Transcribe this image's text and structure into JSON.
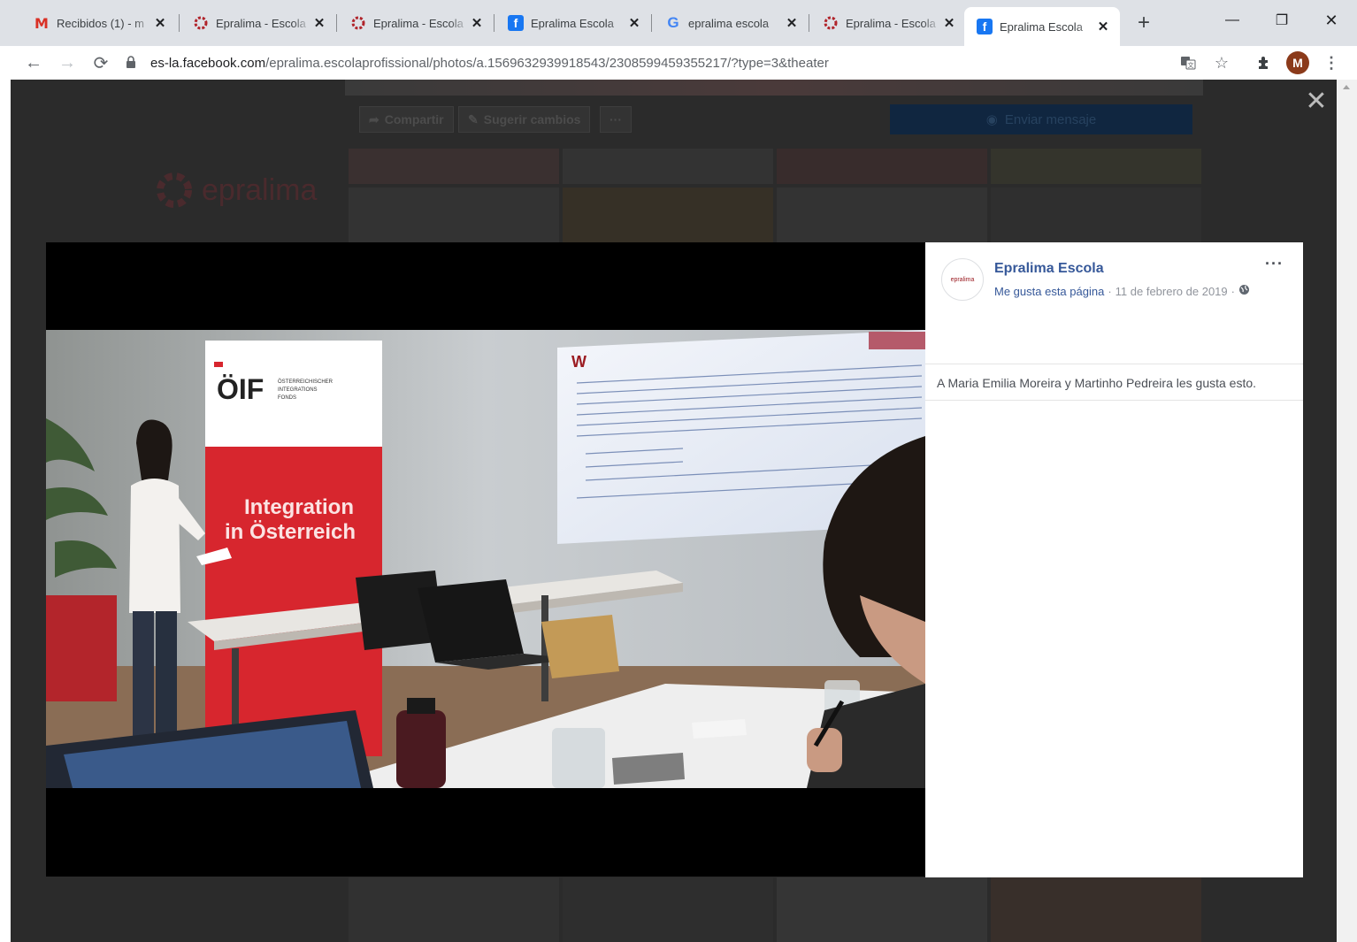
{
  "browser": {
    "tabs": [
      {
        "title": "Recibidos (1) - m",
        "favicon": "gmail-icon"
      },
      {
        "title": "Epralima - Escola",
        "favicon": "epralima-icon"
      },
      {
        "title": "Epralima - Escola",
        "favicon": "epralima-icon"
      },
      {
        "title": "Epralima Escola",
        "favicon": "facebook-icon"
      },
      {
        "title": "epralima escola",
        "favicon": "google-icon"
      },
      {
        "title": "Epralima - Escola",
        "favicon": "epralima-icon"
      },
      {
        "title": "Epralima Escola",
        "favicon": "facebook-icon",
        "active": true
      }
    ],
    "url_host": "es-la.facebook.com",
    "url_path": "/epralima.escolaprofissional/photos/a.1569632939918543/2308599459355217/?type=3&theater",
    "profile_initial": "M"
  },
  "background_page": {
    "share_label": "Compartir",
    "suggest_label": "Sugerir cambios",
    "more_label": "···",
    "send_message_label": "Enviar mensaje",
    "logo_text": "epralima"
  },
  "viewer": {
    "close_symbol": "✕",
    "page_name": "Epralima Escola",
    "like_page": "Me gusta esta página",
    "meta_sep": "·",
    "date": "11 de febrero de 2019",
    "more": "···",
    "likes_text": "A Maria Emilia Moreira y Martinho Pedreira les gusta esto.",
    "avatar_text": "epralima"
  },
  "photo": {
    "banner_line1": "Integration",
    "banner_line2": "in Österreich",
    "banner_logo": "ÖIF",
    "banner_sub1": "ÖSTERREICHISCHER",
    "banner_sub2": "INTEGRATIONS",
    "banner_sub3": "FONDS"
  },
  "colors": {
    "facebook_link": "#365899",
    "banner_red": "#d7262e"
  }
}
